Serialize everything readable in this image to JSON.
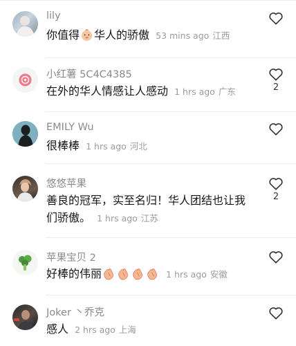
{
  "colors": {
    "username": "#8a8a8a",
    "meta": "#9b9b9b",
    "text": "#161616",
    "divider": "#ececec"
  },
  "comments": [
    {
      "user": "lily",
      "text_before": "你值得",
      "text_after": "华人的骄傲",
      "emoji_icons": [
        "baby-face-emoji"
      ],
      "time": "53 mins ago",
      "location": "江西",
      "likes": "",
      "avatar_icon": "user-photo-avatar"
    },
    {
      "user": "小红薯 5C4C4385",
      "text": "在外的华人情感让人感动",
      "time": "1 hrs ago",
      "location": "广东",
      "likes": "2",
      "avatar_icon": "default-pink-avatar"
    },
    {
      "user": "EMILY Wu",
      "text": "很棒棒",
      "time": "1 hrs ago",
      "location": "河北",
      "likes": "",
      "avatar_icon": "silhouette-avatar"
    },
    {
      "user": "悠悠苹果",
      "text": "善良的冠军，实至名归！华人团结也让我们骄傲。",
      "time": "1 hrs ago",
      "location": "江苏",
      "likes": "2",
      "avatar_icon": "user-photo-avatar"
    },
    {
      "user": "苹果宝贝 2",
      "text": "好棒的伟丽",
      "emoji_icons": [
        "clap-emoji",
        "clap-emoji",
        "clap-emoji",
        "clap-emoji"
      ],
      "time": "1 hrs ago",
      "location": "安徽",
      "likes": "",
      "avatar_icon": "broccoli-avatar"
    },
    {
      "user": "Joker 丶乔克",
      "text": "感人",
      "time": "2 hrs ago",
      "location": "上海",
      "likes": "",
      "avatar_icon": "user-photo-avatar"
    }
  ]
}
